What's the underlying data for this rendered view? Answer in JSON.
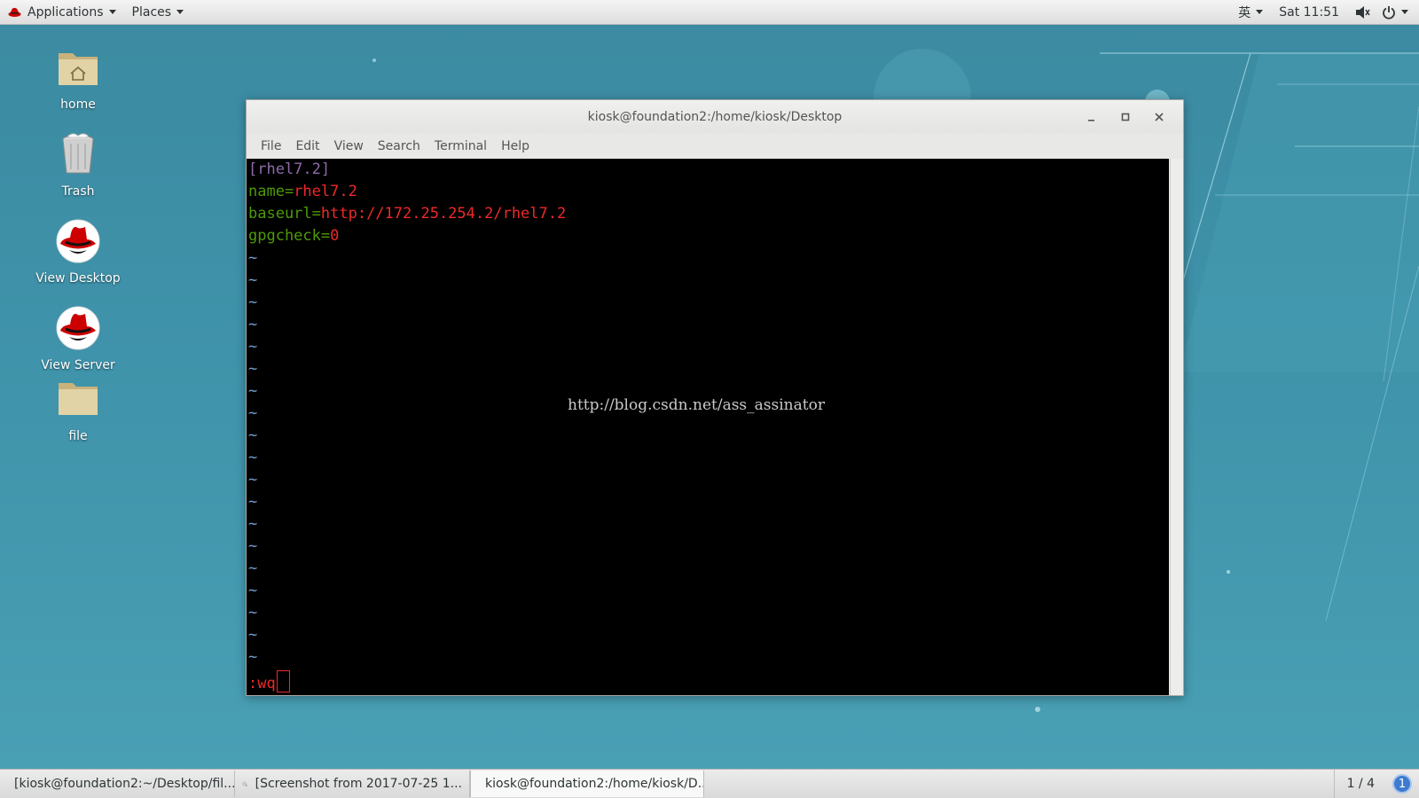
{
  "topbar": {
    "applications": "Applications",
    "places": "Places",
    "input_method": "英",
    "clock": "Sat 11:51"
  },
  "desktop_icons": [
    {
      "label": "home",
      "icon": "folder-home-icon"
    },
    {
      "label": "Trash",
      "icon": "trash-icon"
    },
    {
      "label": "View Desktop",
      "icon": "redhat-icon"
    },
    {
      "label": "View Server",
      "icon": "redhat-icon"
    },
    {
      "label": "file",
      "icon": "folder-icon"
    }
  ],
  "window": {
    "title": "kiosk@foundation2:/home/kiosk/Desktop",
    "menu": [
      "File",
      "Edit",
      "View",
      "Search",
      "Terminal",
      "Help"
    ]
  },
  "terminal": {
    "section": "[rhel7.2]",
    "name_key": "name=",
    "name_val": "rhel7.2",
    "baseurl_key": "baseurl=",
    "baseurl_val": "http://172.25.254.2/rhel7.2",
    "gpgcheck_key": "gpgcheck=",
    "gpgcheck_val": "0",
    "tilde": "~",
    "command": ":wq",
    "watermark": "http://blog.csdn.net/ass_assinator"
  },
  "taskbar": {
    "tasks": [
      "[kiosk@foundation2:~/Desktop/fil...",
      "[Screenshot from 2017-07-25 1...",
      "kiosk@foundation2:/home/kiosk/D..."
    ],
    "workspace": "1 / 4",
    "notifications": "1"
  },
  "colors": {
    "section": "#8e6ba8",
    "key": "#4e9a06",
    "value": "#ef2929",
    "tilde": "#729fcf"
  }
}
